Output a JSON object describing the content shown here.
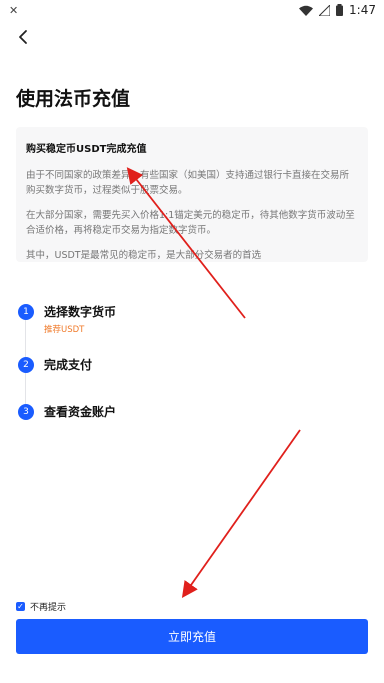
{
  "status_bar": {
    "time": "1:47",
    "left_icon": "settings-icon",
    "icons": [
      "wifi-icon",
      "signal-icon",
      "battery-icon"
    ]
  },
  "header": {
    "back_icon": "chevron-left-icon"
  },
  "page": {
    "title": "使用法币充值"
  },
  "info_card": {
    "title": "购买稳定币USDT完成充值",
    "paragraphs": [
      "由于不同国家的政策差异，有些国家（如美国）支持通过银行卡直接在交易所购买数字货币，过程类似于股票交易。",
      "在大部分国家，需要先买入价格1:1锚定美元的稳定币，待其他数字货币波动至合适价格，再将稳定币交易为指定数字货币。",
      "其中，USDT是最常见的稳定币，是大部分交易者的首选"
    ]
  },
  "steps": [
    {
      "number": "1",
      "label": "选择数字货币",
      "sub": "推荐USDT"
    },
    {
      "number": "2",
      "label": "完成支付"
    },
    {
      "number": "3",
      "label": "查看资金账户"
    }
  ],
  "footer": {
    "checkbox_label": "不再提示",
    "checkbox_checked": true,
    "button_label": "立即充值"
  },
  "colors": {
    "accent": "#1a5cff",
    "orange": "#f07a2a",
    "annotation": "#e0201c"
  }
}
